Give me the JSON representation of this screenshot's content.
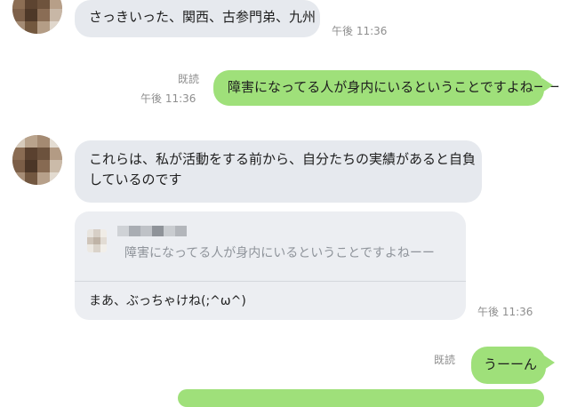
{
  "messages": {
    "m1": {
      "text": "さっきいった、関西、古参門弟、九州",
      "time": "午後 11:36"
    },
    "m2": {
      "read": "既読",
      "time": "午後 11:36",
      "text": "障害になってる人が身内にいるということですよねーー"
    },
    "m3": {
      "line1": "これらは、私が活動をする前から、自分たちの実績があると自負",
      "line2": "しているのです"
    },
    "m4": {
      "quoted_text": "障害になってる人が身内にいるということですよねーー",
      "reply": "まあ、ぶっちゃけね(;^ω^)",
      "time": "午後 11:36"
    },
    "m5": {
      "read": "既読",
      "text": "うーーん"
    }
  },
  "colors": {
    "incoming_bubble": "#e6e9ee",
    "outgoing_bubble": "#9fe07a",
    "meta_text": "#8e8e8e",
    "quote_text": "#8f949b"
  }
}
